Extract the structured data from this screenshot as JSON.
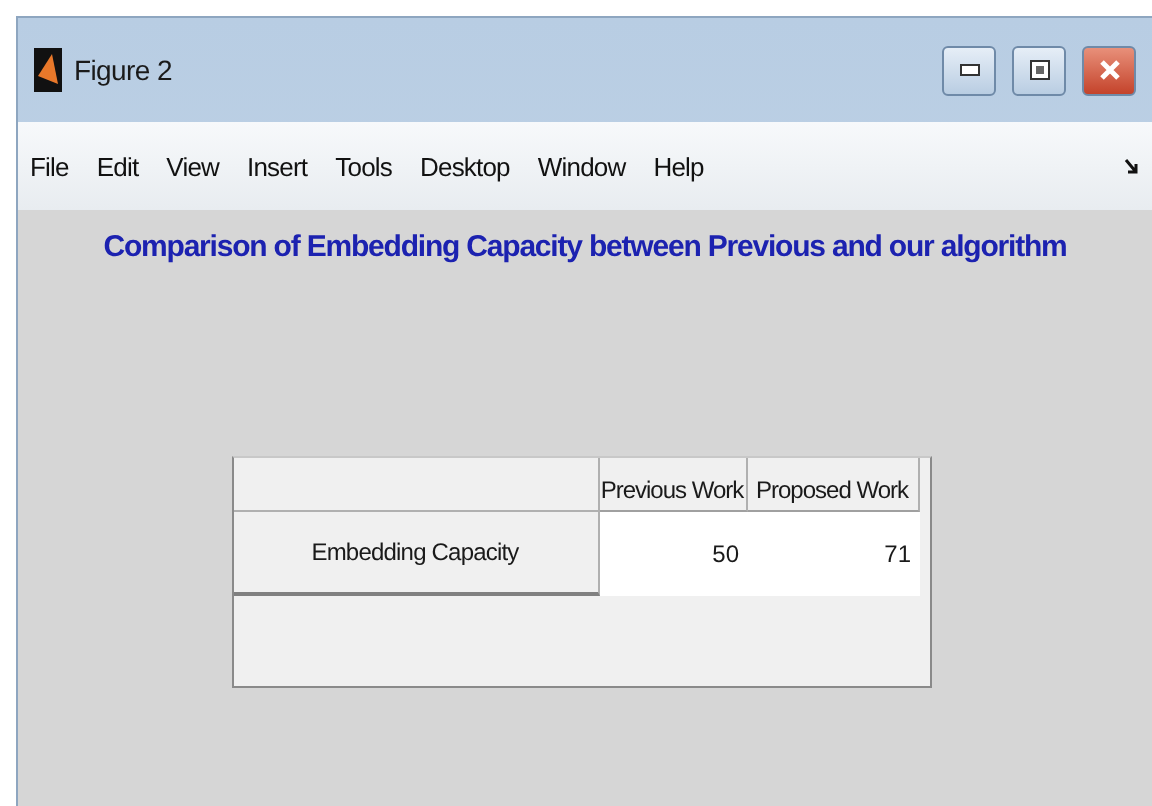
{
  "window": {
    "title": "Figure 2"
  },
  "menu": [
    "File",
    "Edit",
    "View",
    "Insert",
    "Tools",
    "Desktop",
    "Window",
    "Help"
  ],
  "figure": {
    "title": "Comparison of Embedding Capacity between Previous and our algorithm"
  },
  "table": {
    "columns": [
      "Previous Work",
      "Proposed Work"
    ],
    "rows": [
      {
        "header": "Embedding Capacity",
        "cells": [
          "50",
          "71"
        ]
      }
    ]
  }
}
